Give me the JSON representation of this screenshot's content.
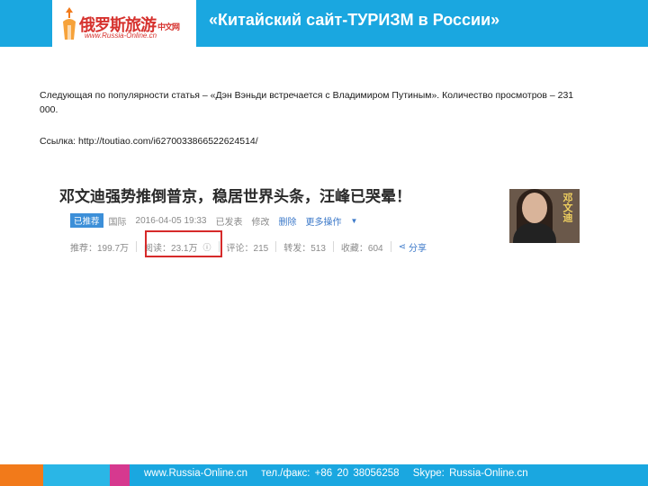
{
  "header": {
    "title": "«Китайский сайт-ТУРИЗМ в России»",
    "logo_cn": "俄罗斯旅游",
    "logo_cn_sub": "中文网",
    "logo_url": "www.Russia-Online.cn",
    "bg_color": "#1aa7e0"
  },
  "content": {
    "paragraph_1": "Следующая по популярности статья – «Дэн Вэньди встречается с Владимиром Путиным». Количество просмотров – 231 000.",
    "paragraph_2": "Ссылка: http://toutiao.com/i6270033866522624514/"
  },
  "article": {
    "title": "邓文迪强势推倒普京，稳居世界头条，汪峰已哭晕！",
    "badge": "已推荐",
    "meta": [
      "国际",
      "2016-04-05 19:33",
      "已发表",
      "修改"
    ],
    "meta_links": [
      "删除",
      "更多操作"
    ],
    "stats": {
      "recommend": "推荐：199.7万",
      "read": "阅读：23.1万",
      "comment": "评论：215",
      "repost": "转发：513",
      "favorite": "收藏：604",
      "share": "分享"
    },
    "photo_caption": "邓文迪"
  },
  "footer": {
    "site": "www.Russia-Online.cn",
    "phone": "тел./факс: +86 20 38056258",
    "skype": "Skype: Russia-Online.cn",
    "colors": [
      "#f27a1a",
      "#2ab6e6",
      "#d6398f",
      "#1aa7e0"
    ]
  }
}
